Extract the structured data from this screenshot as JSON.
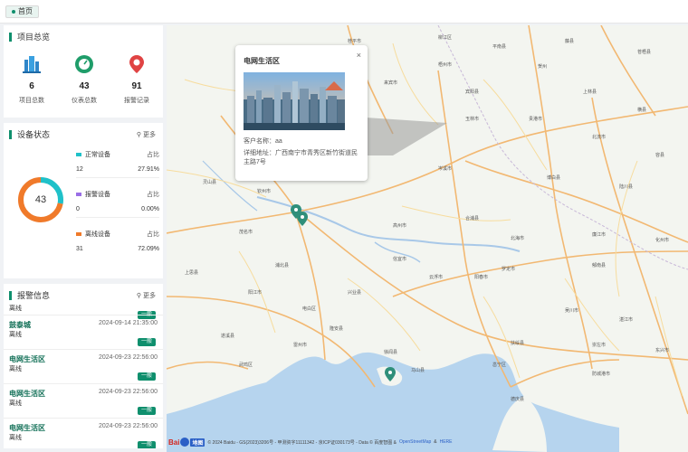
{
  "topbar": {
    "home_tag": "首页"
  },
  "overview": {
    "title": "项目总览",
    "stats": [
      {
        "icon": "buildings-icon",
        "value": "6",
        "label": "项目总数",
        "color": "#2f86c9"
      },
      {
        "icon": "meter-icon",
        "value": "43",
        "label": "仪表总数",
        "color": "#1f9d6a"
      },
      {
        "icon": "alarm-pin-icon",
        "value": "91",
        "label": "报警记录",
        "color": "#e04343"
      }
    ]
  },
  "device": {
    "title": "设备状态",
    "more": "更多",
    "total": "43",
    "ratio_label": "占比",
    "rows": [
      {
        "name": "正常设备",
        "count": "12",
        "pct": "27.91%",
        "color": "#1fc1c9",
        "fraction": 0.2791
      },
      {
        "name": "报警设备",
        "count": "0",
        "pct": "0.00%",
        "color": "#9a6ee6",
        "fraction": 0.0
      },
      {
        "name": "离线设备",
        "count": "31",
        "pct": "72.09%",
        "color": "#f07a2a",
        "fraction": 0.7209
      }
    ]
  },
  "alarms": {
    "title": "报警信息",
    "more": "更多",
    "first_status": "离线",
    "first_tag": "一般",
    "items": [
      {
        "name": "鼓泰城",
        "time": "2024-09-14 21:35:00",
        "status": "离线",
        "tag": "一般"
      },
      {
        "name": "电网生活区",
        "time": "2024-09-23 22:56:00",
        "status": "离线",
        "tag": "一般"
      },
      {
        "name": "电网生活区",
        "time": "2024-09-23 22:56:00",
        "status": "离线",
        "tag": "一般"
      },
      {
        "name": "电网生活区",
        "time": "2024-09-23 22:56:00",
        "status": "离线",
        "tag": "一般"
      }
    ]
  },
  "popup": {
    "title": "电网生活区",
    "close": "×",
    "customer": "客户名称：aa",
    "address": "详细地址：广西南宁市青秀区新竹街道民主路7号"
  },
  "map": {
    "footer_logo": "Bai",
    "footer_logo_map": "地图",
    "footer_text": "© 2024 Baidu - GS(2023)3206号 - 甲测资字11111342 - 京ICP证030173号 - Data © 百度智图 &",
    "footer_link1": "OpenStreetMap",
    "footer_and": "&",
    "footer_link2": "HERE",
    "cities": [
      "柳江区",
      "桂平市",
      "平南县",
      "藤县",
      "苍梧县",
      "贺州",
      "梧州市",
      "来宾市",
      "宾阳县",
      "上林县",
      "横县",
      "贵港市",
      "玉林市",
      "北流市",
      "容县",
      "岑溪市",
      "博白县",
      "陆川县",
      "灵山县",
      "钦州市",
      "合浦县",
      "北海市",
      "廉江市",
      "化州市",
      "茂名市",
      "高州市",
      "信宜市",
      "罗定市",
      "郁南县",
      "云浮市",
      "阳春市",
      "阳江市",
      "电白区",
      "吴川市",
      "湛江市",
      "遂溪县",
      "雷州市",
      "徐闻县",
      "扶绥县",
      "崇左市",
      "隆安县",
      "武鸣区",
      "马山县",
      "邕宁区",
      "防城港市",
      "东兴市",
      "上思县",
      "浦北县",
      "兴业县",
      "德庆县"
    ]
  }
}
